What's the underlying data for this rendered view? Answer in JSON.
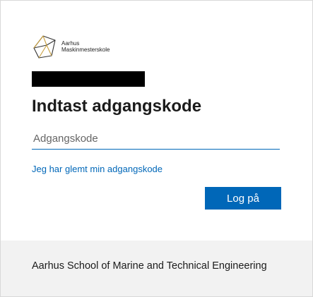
{
  "branding": {
    "logo_line1": "Aarhus",
    "logo_line2": "Maskinmesterskole",
    "logo_icon": "aams-cube-logo-icon"
  },
  "signin": {
    "title": "Indtast adgangskode",
    "password_placeholder": "Adgangskode",
    "password_value": "",
    "forgot_link": "Jeg har glemt min adgangskode",
    "submit_label": "Log på"
  },
  "footer": {
    "text": "Aarhus School of Marine and Technical Engineering"
  },
  "colors": {
    "accent": "#0067b8",
    "footer_bg": "#f2f2f2",
    "redaction": "#000000"
  }
}
